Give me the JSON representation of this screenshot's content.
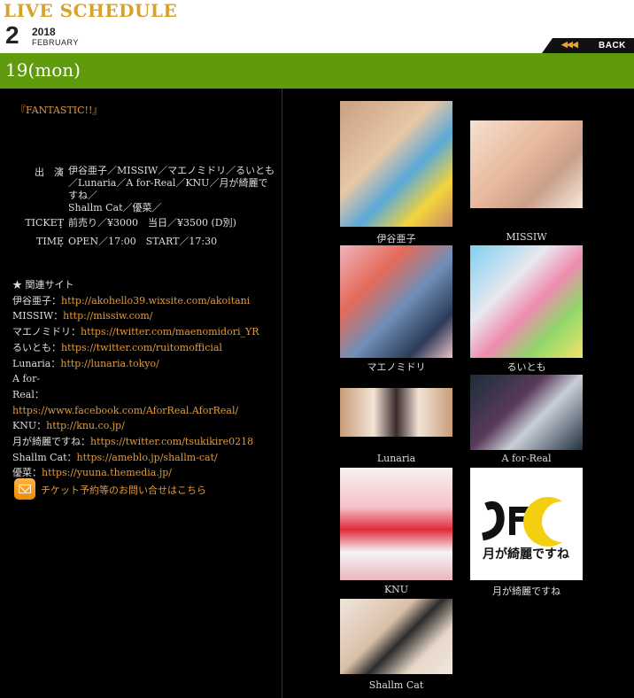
{
  "page": {
    "title": "LIVE SCHEDULE",
    "date_day": "2",
    "date_year": "2018",
    "date_month": "FEBRUARY",
    "back_label": "BACK",
    "back_arrows": "◀◀◀"
  },
  "event": {
    "day": "19(mon)",
    "title": "『FANTASTIC!!』",
    "performers_label": "出　演",
    "performers": [
      "伊谷亜子／MISSIW／マエノミドリ／るいとも",
      "／Lunaria／A for-Real／KNU／月が綺麗ですね／",
      "Shallm Cat／優菜／"
    ],
    "ticket_label": "TICKET",
    "ticket": "前売り／¥3000　当日／¥3500 (D別)",
    "time_label": "TIME",
    "time": "OPEN／17:00　START／17:30",
    "sites_heading": "★ 関連サイト",
    "links": [
      {
        "label": "伊谷亜子：",
        "url": "http://akohello39.wixsite.com/akoitani"
      },
      {
        "label": "MISSIW：",
        "url": "http://missiw.com/"
      },
      {
        "label": "マエノミドリ：",
        "url": "https://twitter.com/maenomidori_YR"
      },
      {
        "label": "るいとも：",
        "url": "https://twitter.com/ruitomofficial"
      },
      {
        "label": "Lunaria：",
        "url": "http://lunaria.tokyo/"
      },
      {
        "label": "A for-Real：",
        "url": "https://www.facebook.com/AforReal.AforReal/"
      },
      {
        "label": "KNU：",
        "url": "http://knu.co.jp/"
      },
      {
        "label": "月が綺麗ですね：",
        "url": "https://twitter.com/tsukikire0218"
      },
      {
        "label": "Shallm Cat：",
        "url": "https://ameblo.jp/shallm-cat/"
      },
      {
        "label": "優菜：",
        "url": "https://yuuna.themedia.jp/"
      }
    ],
    "contact": "チケット予約等のお問い合せはこちら"
  },
  "artists": [
    {
      "name": "伊谷亜子"
    },
    {
      "name": "MISSIW"
    },
    {
      "name": "マエノミドリ"
    },
    {
      "name": "るいとも"
    },
    {
      "name": "Lunaria"
    },
    {
      "name": "A for-Real"
    },
    {
      "name": "KNU"
    },
    {
      "name": "月が綺麗ですね"
    },
    {
      "name": "Shallm Cat"
    }
  ],
  "logo_text": "月が綺麗ですね",
  "colors": {
    "accent": "#e09a3a",
    "daybar": "#5f9b0d",
    "title": "#d8a12a"
  }
}
